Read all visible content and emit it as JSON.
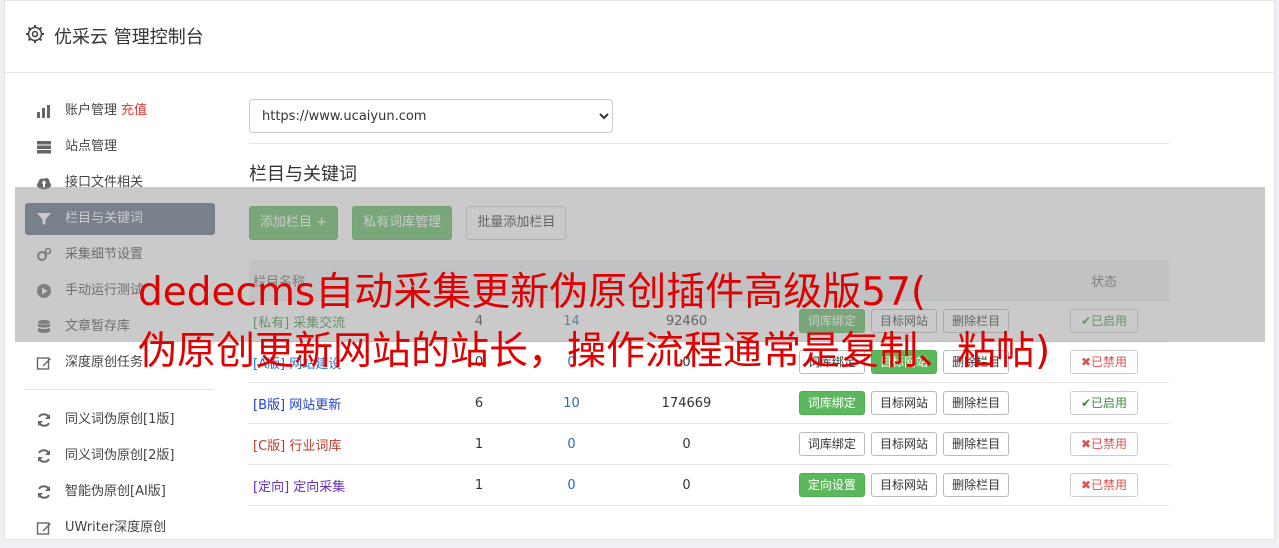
{
  "header": {
    "title": "优采云 管理控制台"
  },
  "sidebar": {
    "items": [
      {
        "label": "账户管理",
        "extra": "充值",
        "icon": "bar-chart-icon"
      },
      {
        "label": "站点管理",
        "icon": "server-icon"
      },
      {
        "label": "接口文件相关",
        "icon": "cloud-upload-icon"
      },
      {
        "label": "栏目与关键词",
        "icon": "filter-icon",
        "active": true
      },
      {
        "label": "采集细节设置",
        "icon": "cogs-icon"
      },
      {
        "label": "手动运行测试",
        "icon": "play-circle-icon"
      },
      {
        "label": "文章暂存库",
        "icon": "database-icon"
      },
      {
        "label": "深度原创任务",
        "icon": "edit-icon"
      }
    ],
    "items2": [
      {
        "label": "同义词伪原创[1版]",
        "icon": "refresh-icon"
      },
      {
        "label": "同义词伪原创[2版]",
        "icon": "refresh-icon"
      },
      {
        "label": "智能伪原创[AI版]",
        "icon": "refresh-icon"
      },
      {
        "label": "UWriter深度原创",
        "icon": "edit-icon"
      }
    ]
  },
  "main": {
    "site_select": "https://www.ucaiyun.com",
    "section_title": "栏目与关键词",
    "buttons": {
      "add_column": "添加栏目 +",
      "private_lib": "私有词库管理",
      "batch_add": "批量添加栏目"
    },
    "table": {
      "headers": {
        "name": "栏目名称",
        "status": "状态"
      },
      "rows": [
        {
          "tag": "[私有]",
          "name": "采集交流",
          "c1": "4",
          "c2": "14",
          "c3": "92460",
          "bind": "词库绑定",
          "target": "目标网站",
          "delete": "删除栏目",
          "status": "已启用"
        },
        {
          "tag": "[A版]",
          "name": "网站建设",
          "c1": "0",
          "c2": "0",
          "c3": "0",
          "bind": "词库绑定",
          "target": "目标网站",
          "delete": "删除栏目",
          "status": "已禁用"
        },
        {
          "tag": "[B版]",
          "name": "网站更新",
          "c1": "6",
          "c2": "10",
          "c3": "174669",
          "bind": "词库绑定",
          "target": "目标网站",
          "delete": "删除栏目",
          "status": "已启用"
        },
        {
          "tag": "[C版]",
          "name": "行业词库",
          "c1": "1",
          "c2": "0",
          "c3": "0",
          "bind": "词库绑定",
          "target": "目标网站",
          "delete": "删除栏目",
          "status": "已禁用"
        },
        {
          "tag": "[定向]",
          "name": "定向采集",
          "c1": "1",
          "c2": "0",
          "c3": "0",
          "bind": "定向设置",
          "target": "目标网站",
          "delete": "删除栏目",
          "status": "已禁用"
        }
      ]
    }
  },
  "watermark": {
    "line1": "dedecms自动采集更新伪原创插件高级版57(",
    "line2": "伪原创更新网站的站长，操作流程通常是复制、粘帖)"
  },
  "colors": {
    "accent_green": "#5cb85c",
    "sidebar_active": "#5a6d80",
    "watermark_red": "#e00000"
  }
}
